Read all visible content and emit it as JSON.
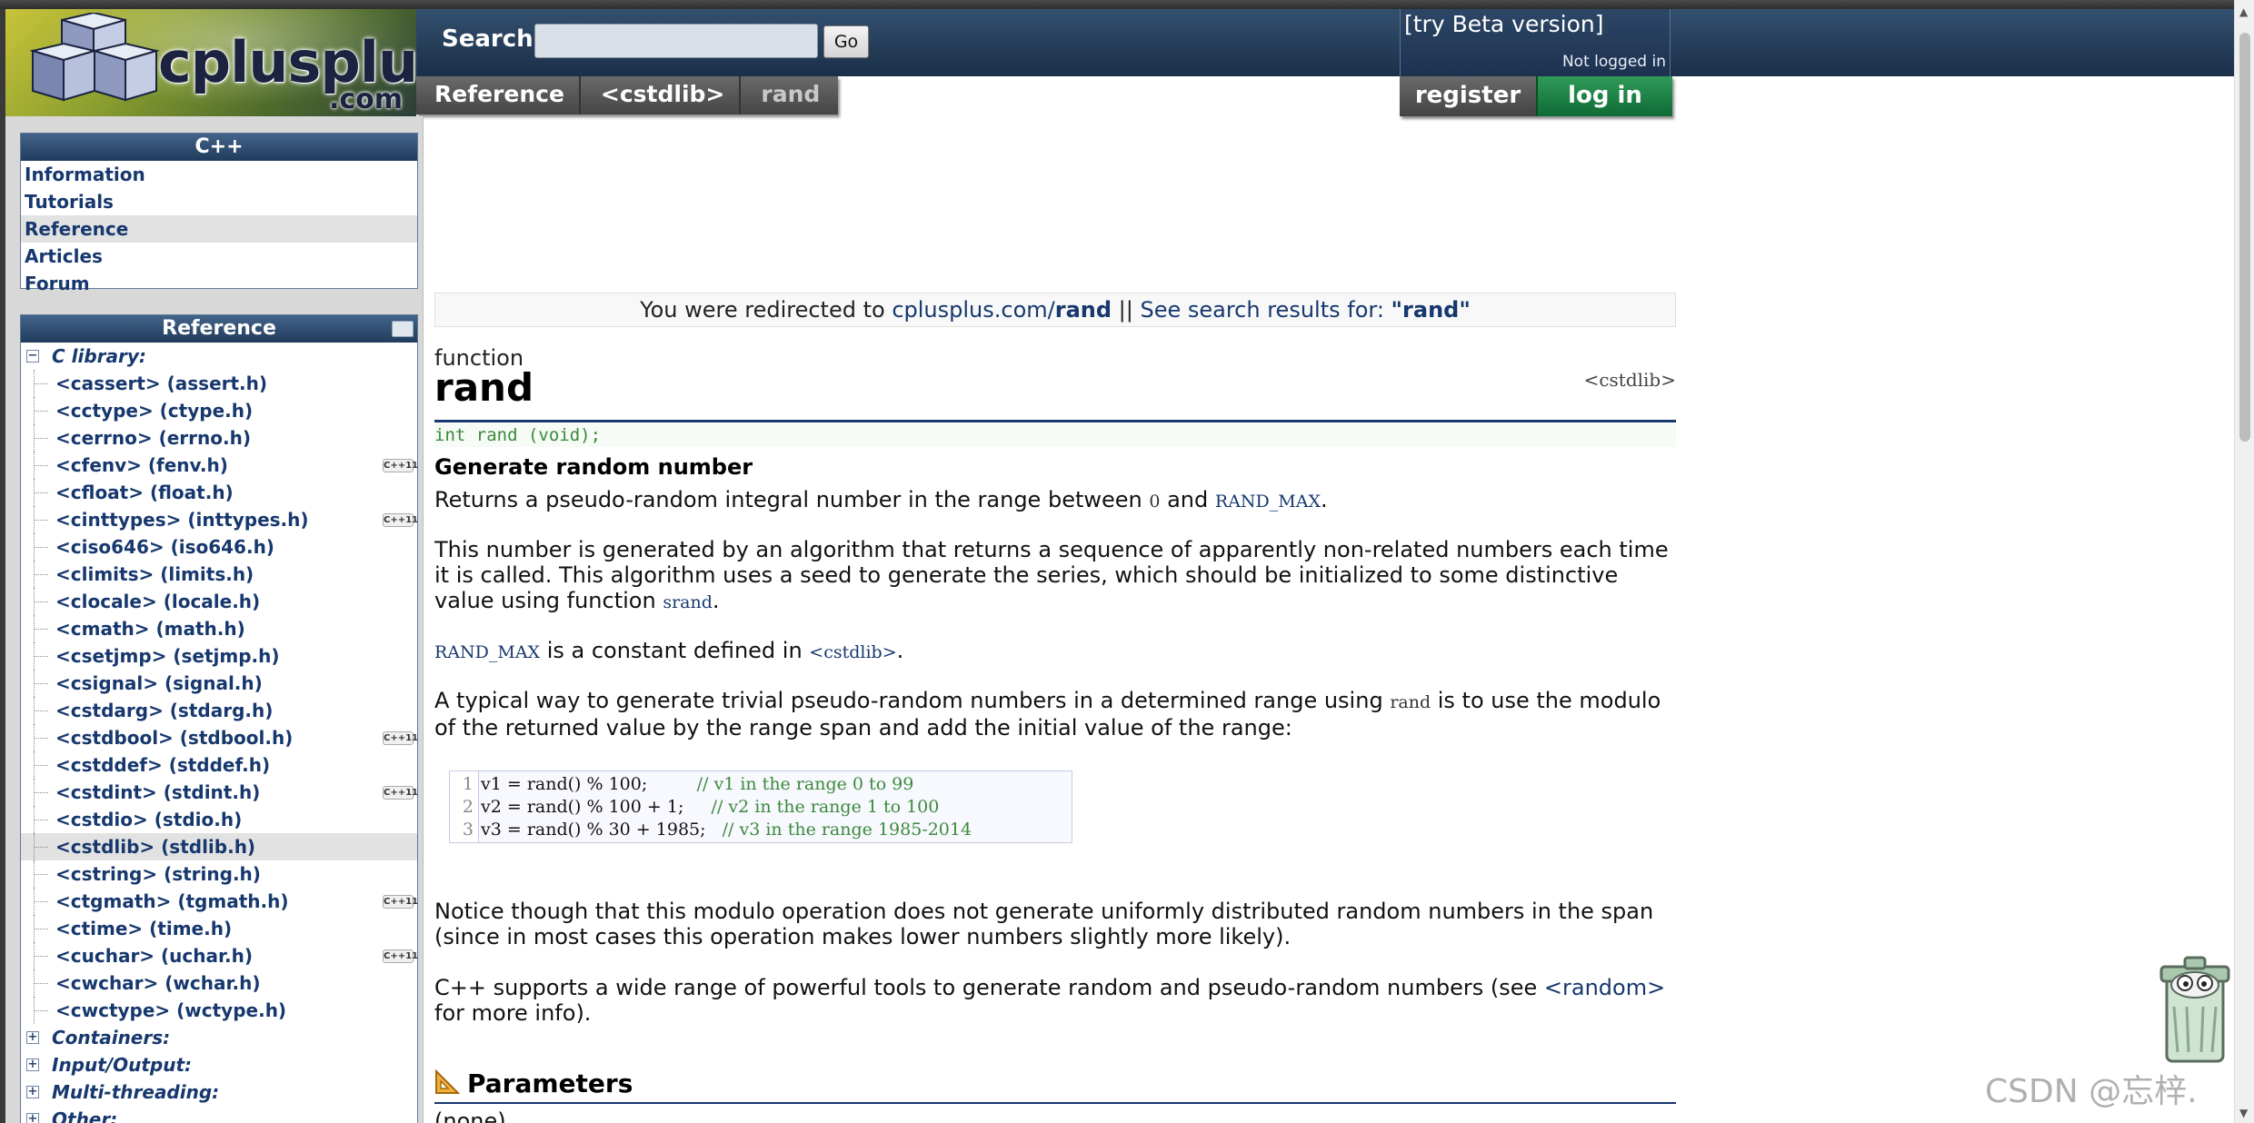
{
  "header": {
    "logo_text": "cplusplus",
    "logo_domain": ".com",
    "search_label": "Search:",
    "search_value": "",
    "go_label": "Go",
    "beta_link": "[try Beta version]",
    "login_status": "Not logged in",
    "register_label": "register",
    "login_label": "log in"
  },
  "breadcrumb": [
    "Reference",
    "<cstdlib>",
    "rand"
  ],
  "sidebar": {
    "cpp_panel_title": "C++",
    "cpp_items": [
      {
        "label": "Information"
      },
      {
        "label": "Tutorials"
      },
      {
        "label": "Reference",
        "active": true
      },
      {
        "label": "Articles"
      },
      {
        "label": "Forum"
      }
    ],
    "ref_panel_title": "Reference",
    "c_library_label": "C library:",
    "c_headers": [
      {
        "label": "<cassert> (assert.h)"
      },
      {
        "label": "<cctype> (ctype.h)"
      },
      {
        "label": "<cerrno> (errno.h)"
      },
      {
        "label": "<cfenv> (fenv.h)",
        "cpp11": true
      },
      {
        "label": "<cfloat> (float.h)"
      },
      {
        "label": "<cinttypes> (inttypes.h)",
        "cpp11": true
      },
      {
        "label": "<ciso646> (iso646.h)"
      },
      {
        "label": "<climits> (limits.h)"
      },
      {
        "label": "<clocale> (locale.h)"
      },
      {
        "label": "<cmath> (math.h)"
      },
      {
        "label": "<csetjmp> (setjmp.h)"
      },
      {
        "label": "<csignal> (signal.h)"
      },
      {
        "label": "<cstdarg> (stdarg.h)"
      },
      {
        "label": "<cstdbool> (stdbool.h)",
        "cpp11": true
      },
      {
        "label": "<cstddef> (stddef.h)"
      },
      {
        "label": "<cstdint> (stdint.h)",
        "cpp11": true
      },
      {
        "label": "<cstdio> (stdio.h)"
      },
      {
        "label": "<cstdlib> (stdlib.h)",
        "active": true
      },
      {
        "label": "<cstring> (string.h)"
      },
      {
        "label": "<ctgmath> (tgmath.h)",
        "cpp11": true
      },
      {
        "label": "<ctime> (time.h)"
      },
      {
        "label": "<cuchar> (uchar.h)",
        "cpp11": true
      },
      {
        "label": "<cwchar> (wchar.h)"
      },
      {
        "label": "<cwctype> (wctype.h)"
      }
    ],
    "other_groups": [
      "Containers:",
      "Input/Output:",
      "Multi-threading:",
      "Other:"
    ],
    "cpp11_badge": "C++11"
  },
  "content": {
    "redirect_prefix": "You were redirected to ",
    "redirect_domain": "cplusplus.com/",
    "redirect_term": "rand",
    "redirect_sep": " || ",
    "search_results_text": "See search results for: ",
    "search_results_term": "\"rand\"",
    "kind": "function",
    "title": "rand",
    "header_file": "<cstdlib>",
    "prototype": "int rand (void);",
    "summary": "Generate random number",
    "p1_a": "Returns a pseudo-random integral number in the range between ",
    "p1_code0": "0",
    "p1_b": " and ",
    "p1_randmax": "RAND_MAX",
    "p1_c": ".",
    "p2_a": "This number is generated by an algorithm that returns a sequence of apparently non-related numbers each time it is called. This algorithm uses a seed to generate the series, which should be initialized to some distinctive value using function ",
    "p2_srand": "srand",
    "p2_b": ".",
    "p3_randmax": "RAND_MAX",
    "p3_a": " is a constant defined in ",
    "p3_header": "<cstdlib>",
    "p3_b": ".",
    "p4_a": "A typical way to generate trivial pseudo-random numbers in a determined range using ",
    "p4_rand": "rand",
    "p4_b": " is to use the modulo of the returned value by the range span and add the initial value of the range:",
    "example_lines": [
      {
        "num": "1",
        "code": "v1 = rand() % 100;         ",
        "comment": "// v1 in the range 0 to 99"
      },
      {
        "num": "2",
        "code": "v2 = rand() % 100 + 1;     ",
        "comment": "// v2 in the range 1 to 100"
      },
      {
        "num": "3",
        "code": "v3 = rand() % 30 + 1985;   ",
        "comment": "// v3 in the range 1985-2014"
      }
    ],
    "p5": "Notice though that this modulo operation does not generate uniformly distributed random numbers in the span (since in most cases this operation makes lower numbers slightly more likely).",
    "p6_a": "C++ supports a wide range of powerful tools to generate random and pseudo-random numbers (see ",
    "p6_link": "<random>",
    "p6_b": " for more info).",
    "parameters_title": "Parameters",
    "parameters_first": "(none)"
  },
  "watermark": "CSDN @忘梓."
}
